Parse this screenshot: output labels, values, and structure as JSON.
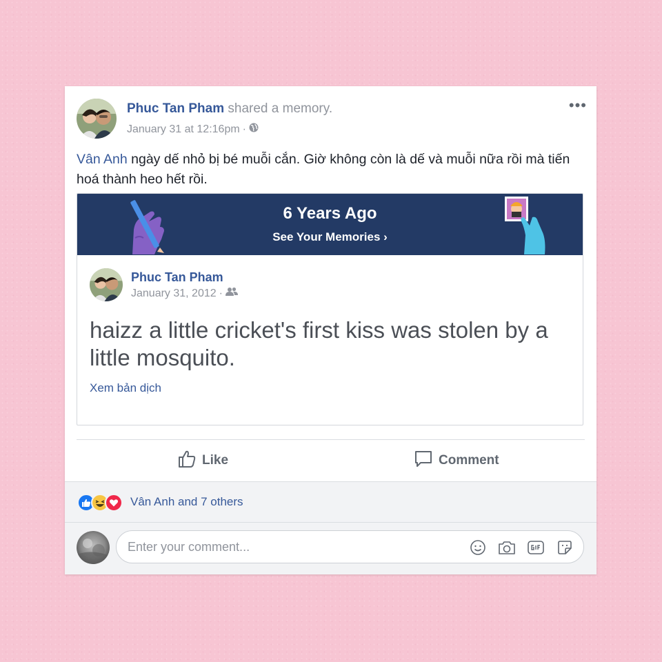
{
  "post": {
    "author": "Phuc Tan Pham",
    "action": "shared a memory.",
    "timestamp": "January 31 at 12:16pm",
    "separator": "·",
    "privacy_icon": "globe-icon",
    "menu_label": "•••",
    "text_tag": "Vân Anh",
    "text_body": " ngày dế nhỏ bị bé muỗi cắn. Giờ không còn là dế và muỗi nữa rồi mà tiến hoá thành heo hết rồi."
  },
  "memory": {
    "banner_title": "6 Years Ago",
    "banner_link": "See Your Memories ›",
    "colors": {
      "banner": "#233a65",
      "purple_hand": "#8561c5",
      "blue_hand": "#4ec3e6"
    },
    "original": {
      "author": "Phuc Tan Pham",
      "date": "January 31, 2012",
      "separator": "·",
      "audience_icon": "friends-icon",
      "text": "haizz a little cricket's first kiss was stolen by a little mosquito.",
      "translate_label": "Xem bản dịch"
    }
  },
  "actions": {
    "like_label": "Like",
    "comment_label": "Comment"
  },
  "reactions": {
    "icons": [
      "like-reaction-icon",
      "haha-reaction-icon",
      "love-reaction-icon"
    ],
    "summary": "Vân Anh and 7 others"
  },
  "comment_box": {
    "placeholder": "Enter your comment...",
    "tools": [
      "emoji-icon",
      "camera-icon",
      "gif-icon",
      "sticker-icon"
    ]
  },
  "theme": {
    "link_blue": "#365899",
    "background_pink": "#f7c5d3"
  }
}
